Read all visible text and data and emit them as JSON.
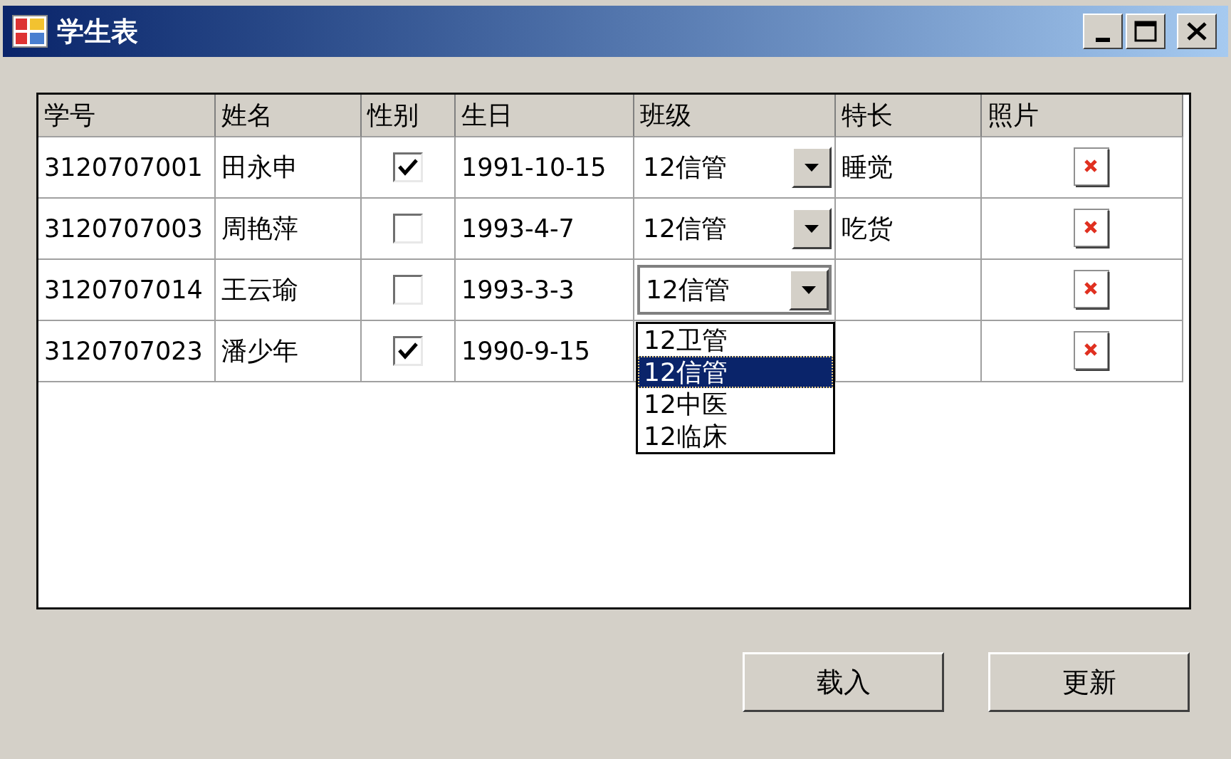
{
  "window": {
    "title": "学生表"
  },
  "grid": {
    "columns": [
      "学号",
      "姓名",
      "性别",
      "生日",
      "班级",
      "特长",
      "照片"
    ],
    "rows": [
      {
        "id": "3120707001",
        "name": "田永申",
        "checked": true,
        "birthday": "1991-10-15",
        "class": {
          "value": "12信管"
        },
        "specialty": "睡觉"
      },
      {
        "id": "3120707003",
        "name": "周艳萍",
        "checked": false,
        "birthday": "1993-4-7",
        "class": {
          "value": "12信管"
        },
        "specialty": "吃货"
      },
      {
        "id": "3120707014",
        "name": "王云瑜",
        "checked": false,
        "birthday": "1993-3-3",
        "class": {
          "value": "12信管",
          "options": [
            {
              "label": "12卫管",
              "selected": false
            },
            {
              "label": "12信管",
              "selected": true
            },
            {
              "label": "12中医",
              "selected": false
            },
            {
              "label": "12临床",
              "selected": false
            }
          ]
        }
      },
      {
        "id": "3120707023",
        "name": "潘少年",
        "checked": true,
        "birthday": "1990-9-15"
      }
    ]
  },
  "buttons": [
    "载入",
    "更新"
  ]
}
